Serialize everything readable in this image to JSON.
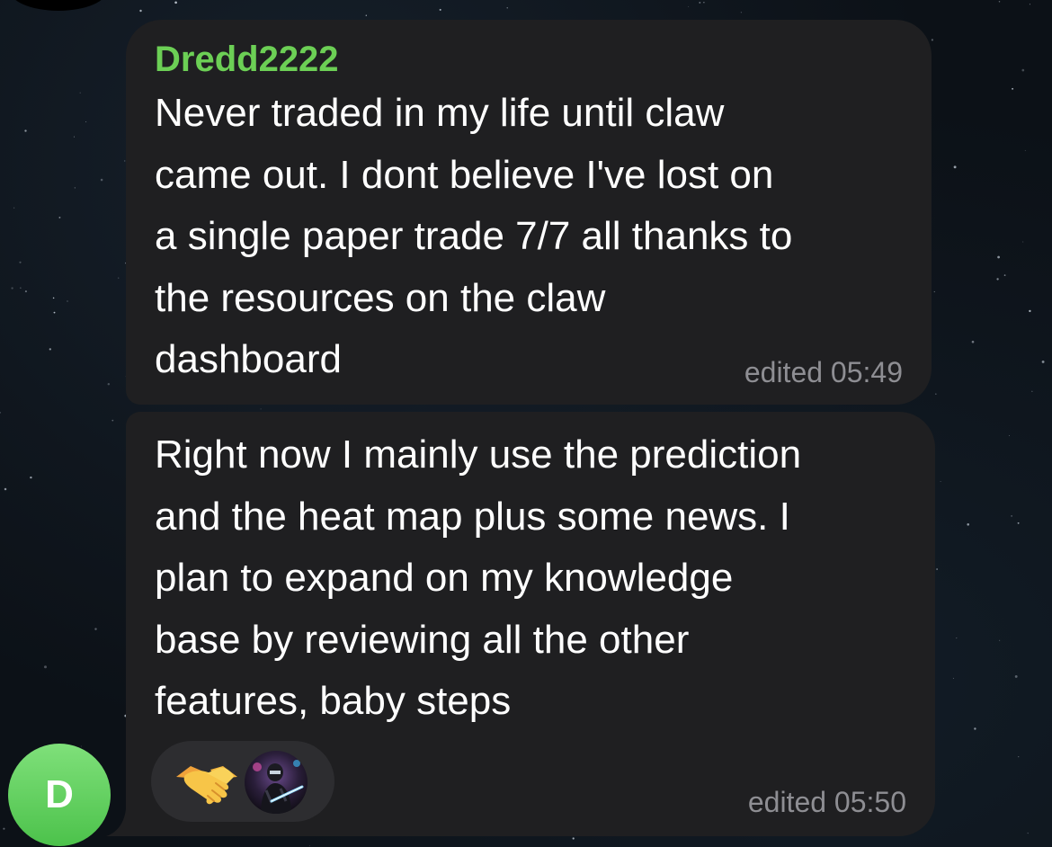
{
  "messages": [
    {
      "sender": "Dredd2222",
      "lines": [
        "Never traded in my life until claw",
        "came out. I dont believe I've lost on",
        "a single paper trade 7/7 all thanks to",
        "the resources on the claw",
        "dashboard"
      ],
      "meta": "edited 05:49"
    },
    {
      "lines": [
        "Right now I mainly use the prediction",
        "and the heat map plus some news. I",
        "plan to expand on my knowledge",
        "base by reviewing all the other",
        "features, baby steps"
      ],
      "meta": "edited 05:50",
      "reactions": [
        {
          "icon": "handshake-icon",
          "type": "emoji"
        },
        {
          "icon": "reactor-avatar",
          "type": "avatar"
        }
      ]
    }
  ],
  "avatar": {
    "initial": "D",
    "color": "#5bd05a"
  },
  "colors": {
    "sender_name": "#6ccf55",
    "bubble": "#1f1f21",
    "meta": "#8e8e93",
    "reaction_pill": "#2d2d30"
  }
}
